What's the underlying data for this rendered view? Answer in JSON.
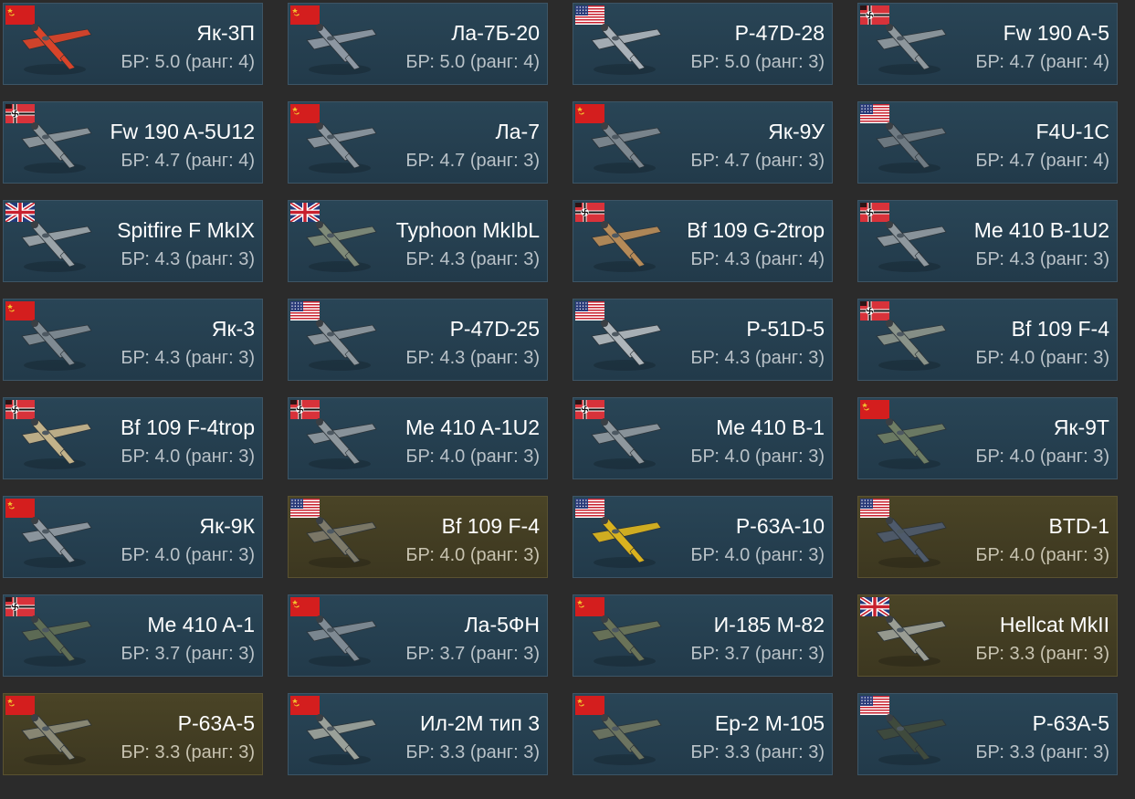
{
  "colors": {
    "standard_bg": "#294556",
    "premium_bg": "#4a4426",
    "page_bg": "#2b2b2b"
  },
  "vehicles": [
    {
      "name": "Як-3П",
      "br": "БР: 5.0 (ранг: 4)",
      "flag": "ussr",
      "premium": false,
      "plane_color": "#d8442a"
    },
    {
      "name": "Ла-7Б-20",
      "br": "БР: 5.0 (ранг: 4)",
      "flag": "ussr",
      "premium": false,
      "plane_color": "#8d97a2"
    },
    {
      "name": "P-47D-28",
      "br": "БР: 5.0 (ранг: 3)",
      "flag": "usa",
      "premium": false,
      "plane_color": "#a9b1b8"
    },
    {
      "name": "Fw 190 A-5",
      "br": "БР: 4.7 (ранг: 4)",
      "flag": "germany",
      "premium": false,
      "plane_color": "#8e979c"
    },
    {
      "name": "Fw 190 A-5U12",
      "br": "БР: 4.7 (ранг: 4)",
      "flag": "germany",
      "premium": false,
      "plane_color": "#8e979c"
    },
    {
      "name": "Ла-7",
      "br": "БР: 4.7 (ранг: 3)",
      "flag": "ussr",
      "premium": false,
      "plane_color": "#8b959d"
    },
    {
      "name": "Як-9У",
      "br": "БР: 4.7 (ранг: 3)",
      "flag": "ussr",
      "premium": false,
      "plane_color": "#7d878f"
    },
    {
      "name": "F4U-1C",
      "br": "БР: 4.7 (ранг: 4)",
      "flag": "usa",
      "premium": false,
      "plane_color": "#6f7a82"
    },
    {
      "name": "Spitfire F MkIX",
      "br": "БР: 4.3 (ранг: 3)",
      "flag": "uk",
      "premium": false,
      "plane_color": "#9aa3a8"
    },
    {
      "name": "Typhoon MkIbL",
      "br": "БР: 4.3 (ранг: 3)",
      "flag": "uk",
      "premium": false,
      "plane_color": "#7f8a78"
    },
    {
      "name": "Bf 109 G-2trop",
      "br": "БР: 4.3 (ранг: 4)",
      "flag": "germany",
      "premium": false,
      "plane_color": "#b58a58"
    },
    {
      "name": "Me 410 B-1U2",
      "br": "БР: 4.3 (ранг: 3)",
      "flag": "germany",
      "premium": false,
      "plane_color": "#8f989e"
    },
    {
      "name": "Як-3",
      "br": "БР: 4.3 (ранг: 3)",
      "flag": "ussr",
      "premium": false,
      "plane_color": "#7f8a92"
    },
    {
      "name": "P-47D-25",
      "br": "БР: 4.3 (ранг: 3)",
      "flag": "usa",
      "premium": false,
      "plane_color": "#8e979d"
    },
    {
      "name": "P-51D-5",
      "br": "БР: 4.3 (ранг: 3)",
      "flag": "usa",
      "premium": false,
      "plane_color": "#aeb5ba"
    },
    {
      "name": "Bf 109 F-4",
      "br": "БР: 4.0 (ранг: 3)",
      "flag": "germany",
      "premium": false,
      "plane_color": "#8a9389"
    },
    {
      "name": "Bf 109 F-4trop",
      "br": "БР: 4.0 (ранг: 3)",
      "flag": "germany",
      "premium": false,
      "plane_color": "#c2b28a"
    },
    {
      "name": "Me 410 A-1U2",
      "br": "БР: 4.0 (ранг: 3)",
      "flag": "germany",
      "premium": false,
      "plane_color": "#8e979d"
    },
    {
      "name": "Me 410 B-1",
      "br": "БР: 4.0 (ранг: 3)",
      "flag": "germany",
      "premium": false,
      "plane_color": "#8e979d"
    },
    {
      "name": "Як-9Т",
      "br": "БР: 4.0 (ранг: 3)",
      "flag": "ussr",
      "premium": false,
      "plane_color": "#6e7d64"
    },
    {
      "name": "Як-9К",
      "br": "БР: 4.0 (ранг: 3)",
      "flag": "ussr",
      "premium": false,
      "plane_color": "#9099a1"
    },
    {
      "name": "Bf 109 F-4",
      "br": "БР: 4.0 (ранг: 3)",
      "flag": "usa",
      "premium": true,
      "plane_color": "#7d7a6a"
    },
    {
      "name": "P-63A-10",
      "br": "БР: 4.0 (ранг: 3)",
      "flag": "usa",
      "premium": false,
      "plane_color": "#d9b21f"
    },
    {
      "name": "BTD-1",
      "br": "БР: 4.0 (ранг: 3)",
      "flag": "usa",
      "premium": true,
      "plane_color": "#4e5a6b"
    },
    {
      "name": "Me 410 A-1",
      "br": "БР: 3.7 (ранг: 3)",
      "flag": "germany",
      "premium": false,
      "plane_color": "#5f6d55"
    },
    {
      "name": "Ла-5ФН",
      "br": "БР: 3.7 (ранг: 3)",
      "flag": "ussr",
      "premium": false,
      "plane_color": "#7f8a93"
    },
    {
      "name": "И-185 М-82",
      "br": "БР: 3.7 (ранг: 3)",
      "flag": "ussr",
      "premium": false,
      "plane_color": "#6a7358"
    },
    {
      "name": "Hellcat MkII",
      "br": "БР: 3.3 (ранг: 3)",
      "flag": "uk",
      "premium": true,
      "plane_color": "#9a9d94"
    },
    {
      "name": "P-63A-5",
      "br": "БР: 3.3 (ранг: 3)",
      "flag": "ussr",
      "premium": true,
      "plane_color": "#8b8a78"
    },
    {
      "name": "Ил-2М тип 3",
      "br": "БР: 3.3 (ранг: 3)",
      "flag": "ussr",
      "premium": false,
      "plane_color": "#9aa099"
    },
    {
      "name": "Ер-2 М-105",
      "br": "БР: 3.3 (ранг: 3)",
      "flag": "ussr",
      "premium": false,
      "plane_color": "#6c7460"
    },
    {
      "name": "P-63A-5",
      "br": "БР: 3.3 (ранг: 3)",
      "flag": "usa",
      "premium": false,
      "plane_color": "#3f4a3c"
    }
  ]
}
